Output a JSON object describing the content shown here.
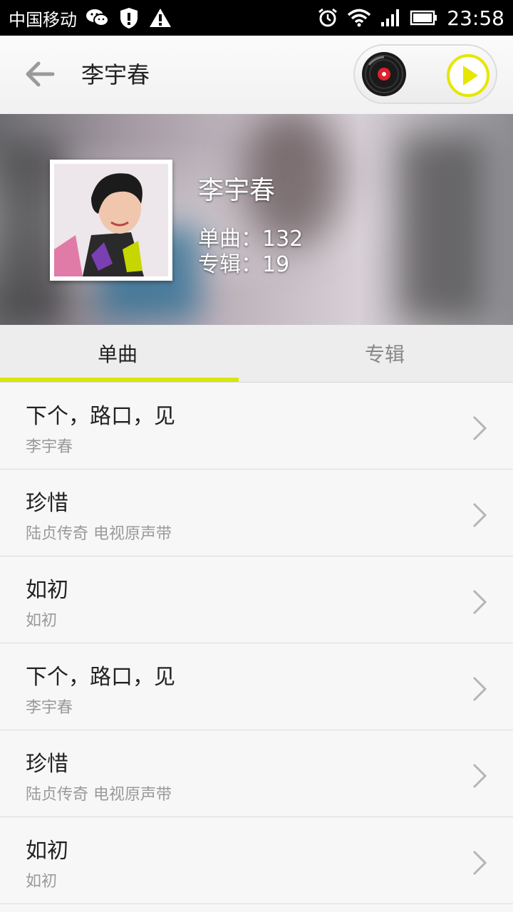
{
  "status_bar": {
    "carrier": "中国移动",
    "time": "23:58",
    "icons": [
      "wechat-icon",
      "shield-icon",
      "warning-icon",
      "alarm-icon",
      "wifi-icon",
      "signal-icon",
      "battery-icon"
    ]
  },
  "header": {
    "back_icon": "back-arrow-icon",
    "title": "李宇春",
    "player": {
      "disc_icon": "vinyl-disc-icon",
      "play_icon": "play-icon"
    }
  },
  "artist": {
    "name": "李宇春",
    "singles_text": "单曲：132",
    "albums_text": "专辑：19"
  },
  "tabs": [
    {
      "label": "单曲",
      "active": true
    },
    {
      "label": "专辑",
      "active": false
    }
  ],
  "songs": [
    {
      "title": "下个，路口，见",
      "subtitle": "李宇春"
    },
    {
      "title": "珍惜",
      "subtitle": "陆贞传奇 电视原声带"
    },
    {
      "title": "如初",
      "subtitle": "如初"
    },
    {
      "title": "下个，路口，见",
      "subtitle": "李宇春"
    },
    {
      "title": "珍惜",
      "subtitle": "陆贞传奇 电视原声带"
    },
    {
      "title": "如初",
      "subtitle": "如初"
    }
  ],
  "colors": {
    "accent": "#d8e800",
    "status_bar": "#000000",
    "title_text": "#222222",
    "secondary_text": "#9a9a9a"
  }
}
